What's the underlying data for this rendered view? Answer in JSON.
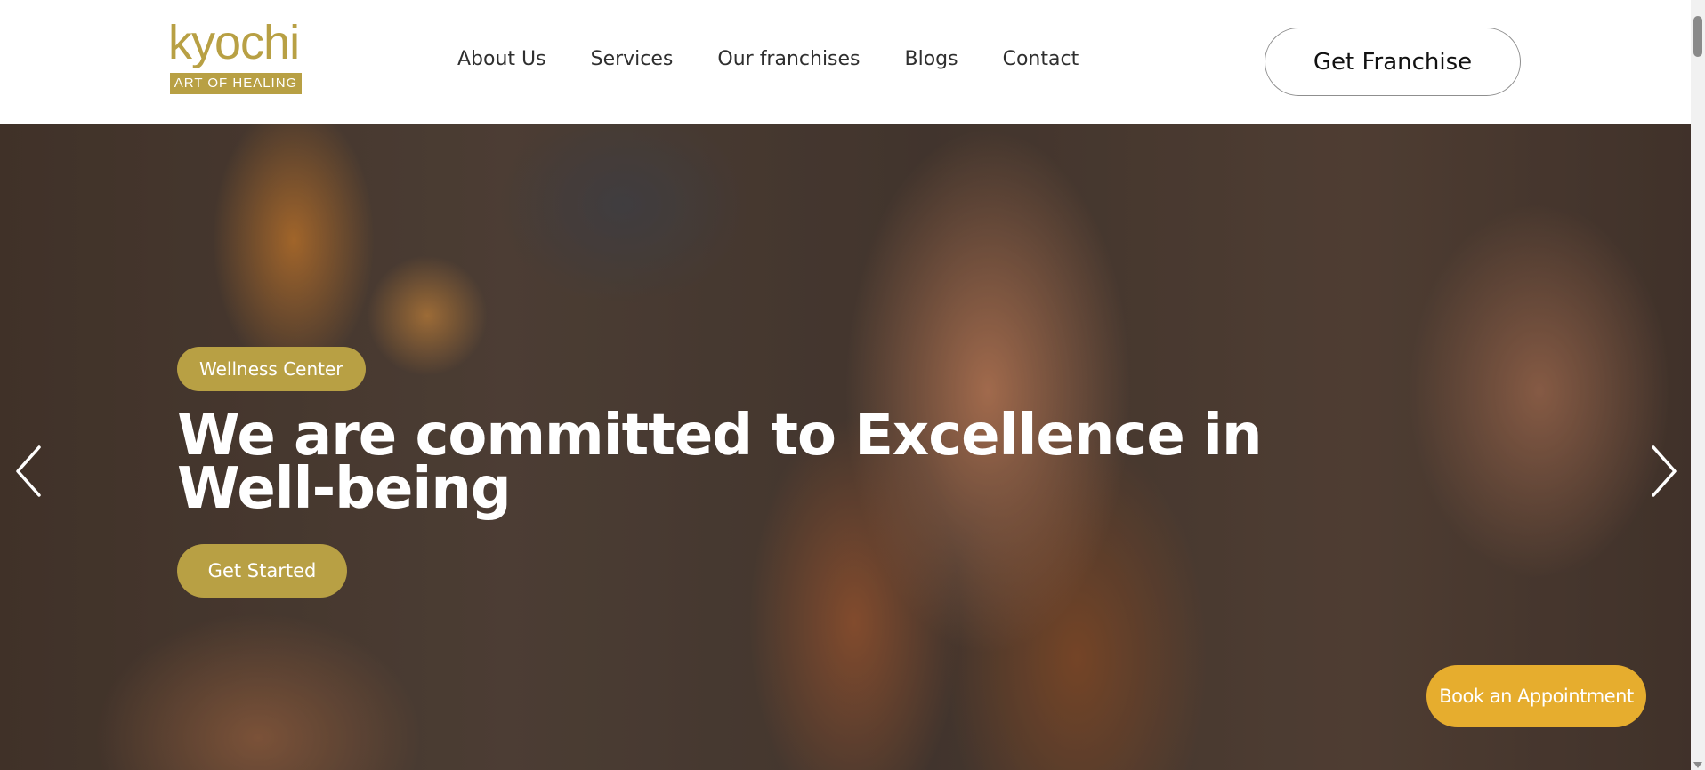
{
  "header": {
    "logo": {
      "word": "kyochi",
      "tagline": "ART OF HEALING"
    },
    "nav": [
      {
        "label": "About Us"
      },
      {
        "label": "Services"
      },
      {
        "label": "Our franchises"
      },
      {
        "label": "Blogs"
      },
      {
        "label": "Contact"
      }
    ],
    "cta_label": "Get Franchise"
  },
  "hero": {
    "badge": "Wellness Center",
    "title": "We are committed to Excellence in Well-being",
    "button_label": "Get Started",
    "prev_icon": "chevron-left-icon",
    "next_icon": "chevron-right-icon"
  },
  "floating": {
    "book_label": "Book an Appointment"
  },
  "colors": {
    "brand_gold": "#b8a044",
    "book_button": "#e6ad2e",
    "nav_text": "#2f2f2f"
  }
}
